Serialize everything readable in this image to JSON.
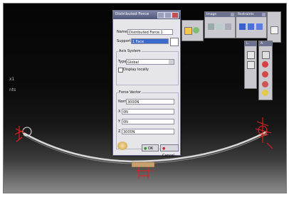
{
  "tree": {
    "item1": "x1",
    "item2": "nts"
  },
  "dialog": {
    "title": "Distributed Force",
    "name_label": "Name",
    "name_value": "Distributed Force.1",
    "supports_label": "Supports",
    "supports_value": "1 Face",
    "axis_group": "Axis System",
    "type_label": "Type",
    "type_value": "Global",
    "display_locally": "Display locally",
    "force_group": "Force Vector",
    "norm_label": "Norm",
    "norm_value": "3000N",
    "x_label": "X",
    "x_value": "0N",
    "y_label": "Y",
    "y_value": "0N",
    "z_label": "Z",
    "z_value": "3000N",
    "ok_label": "OK",
    "cancel_label": "Cancel"
  },
  "toolbars": {
    "image": "Image",
    "restraints": "Restraints",
    "loads": "L.",
    "analysis": "A."
  },
  "colors": {
    "annotation_red": "#e02020",
    "dialog_title": "#5a6180",
    "part_accent": "#c8a070"
  }
}
